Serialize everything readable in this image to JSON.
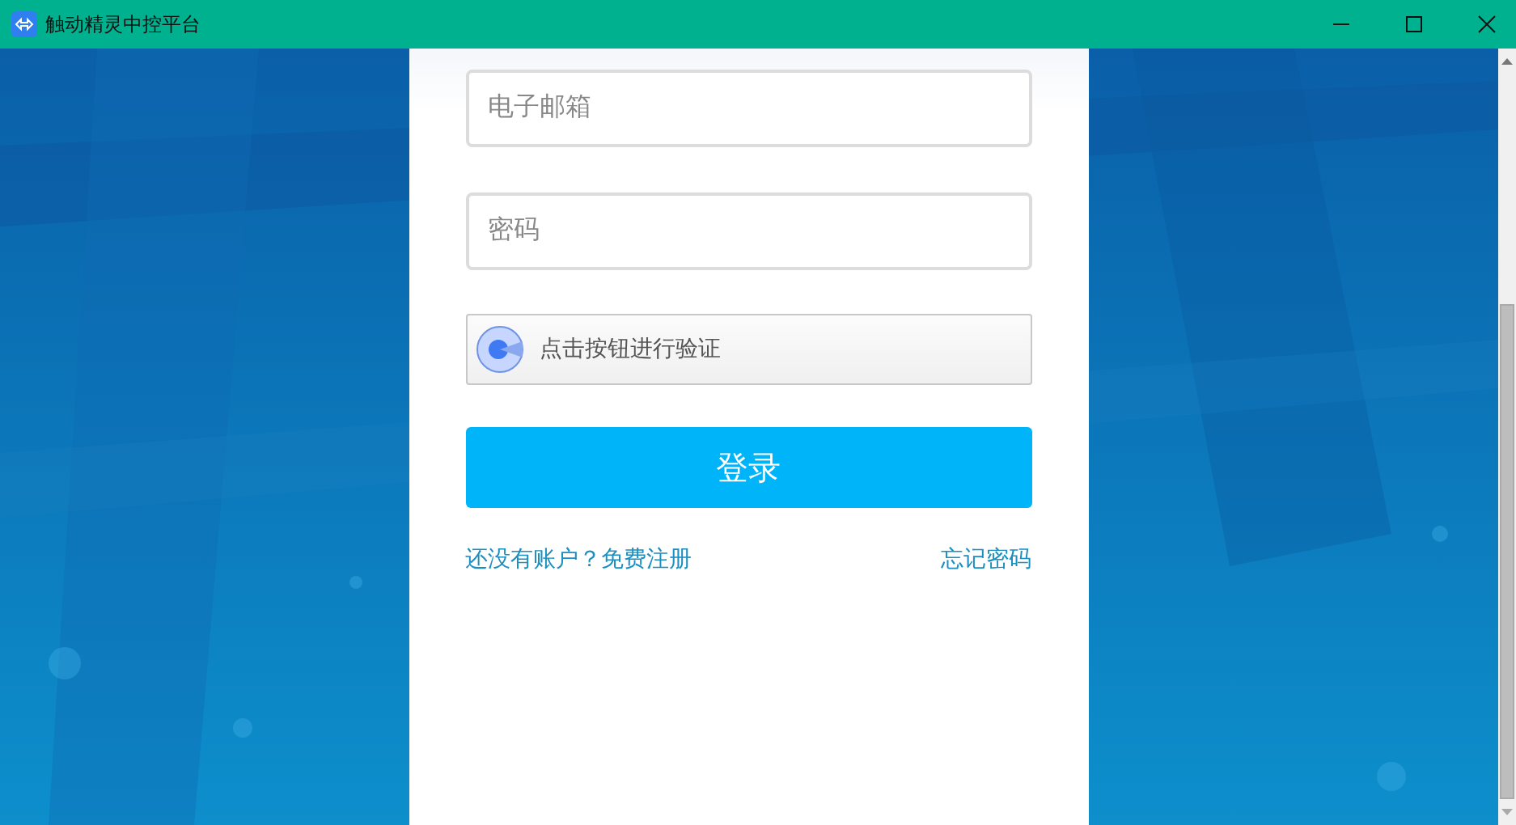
{
  "window": {
    "title": "触动精灵中控平台"
  },
  "login_form": {
    "email": {
      "placeholder": "电子邮箱"
    },
    "password": {
      "placeholder": "密码"
    },
    "captcha": {
      "label": "点击按钮进行验证"
    },
    "login_button": "登录",
    "register_link": "还没有账户？免费注册",
    "forgot_link": "忘记密码"
  }
}
